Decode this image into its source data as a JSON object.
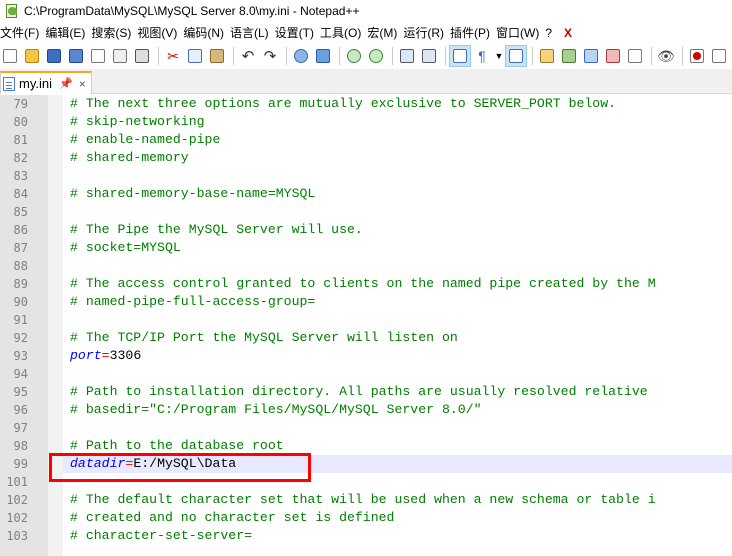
{
  "window": {
    "title": "C:\\ProgramData\\MySQL\\MySQL Server 8.0\\my.ini - Notepad++"
  },
  "menu": {
    "items": [
      "文件(F)",
      "编辑(E)",
      "搜索(S)",
      "视图(V)",
      "编码(N)",
      "语言(L)",
      "设置(T)",
      "工具(O)",
      "宏(M)",
      "运行(R)",
      "插件(P)",
      "窗口(W)",
      "?"
    ],
    "close": "X"
  },
  "toolbar": {
    "icons": [
      "new-file-icon",
      "open-file-icon",
      "save-icon",
      "save-all-icon",
      "close-icon",
      "close-all-icon",
      "print-icon",
      "cut-icon",
      "copy-icon",
      "paste-icon",
      "undo-icon",
      "redo-icon",
      "find-icon",
      "replace-icon",
      "zoom-in-icon",
      "zoom-out-icon",
      "sync-vertical-icon",
      "sync-horizontal-icon",
      "word-wrap-icon",
      "show-all-chars-icon",
      "dropdown-icon",
      "indent-guide-icon",
      "user-language-icon",
      "doc-map-icon",
      "function-list-icon",
      "folder-workspace-icon",
      "monitoring-icon",
      "record-macro-icon"
    ]
  },
  "tab": {
    "label": "my.ini",
    "pin": "📌",
    "close": "×"
  },
  "editor": {
    "lines": [
      {
        "no": "79",
        "parts": [
          {
            "t": "c",
            "s": "# The next three options are mutually exclusive to SERVER_PORT below."
          }
        ]
      },
      {
        "no": "80",
        "parts": [
          {
            "t": "c",
            "s": "# skip-networking"
          }
        ]
      },
      {
        "no": "81",
        "parts": [
          {
            "t": "c",
            "s": "# enable-named-pipe"
          }
        ]
      },
      {
        "no": "82",
        "parts": [
          {
            "t": "c",
            "s": "# shared-memory"
          }
        ]
      },
      {
        "no": "83",
        "parts": []
      },
      {
        "no": "84",
        "parts": [
          {
            "t": "c",
            "s": "# shared-memory-base-name=MYSQL"
          }
        ]
      },
      {
        "no": "85",
        "parts": []
      },
      {
        "no": "86",
        "parts": [
          {
            "t": "c",
            "s": "# The Pipe the MySQL Server will use."
          }
        ]
      },
      {
        "no": "87",
        "parts": [
          {
            "t": "c",
            "s": "# socket=MYSQL"
          }
        ]
      },
      {
        "no": "88",
        "parts": []
      },
      {
        "no": "89",
        "parts": [
          {
            "t": "c",
            "s": "# The access control granted to clients on the named pipe created by the M"
          }
        ]
      },
      {
        "no": "90",
        "parts": [
          {
            "t": "c",
            "s": "# named-pipe-full-access-group="
          }
        ]
      },
      {
        "no": "91",
        "parts": []
      },
      {
        "no": "92",
        "parts": [
          {
            "t": "c",
            "s": "# The TCP/IP Port the MySQL Server will listen on"
          }
        ]
      },
      {
        "no": "93",
        "parts": [
          {
            "t": "k",
            "s": "port"
          },
          {
            "t": "o",
            "s": "="
          },
          {
            "t": "v",
            "s": "3306"
          }
        ]
      },
      {
        "no": "94",
        "parts": []
      },
      {
        "no": "95",
        "parts": [
          {
            "t": "c",
            "s": "# Path to installation directory. All paths are usually resolved relative"
          }
        ]
      },
      {
        "no": "96",
        "parts": [
          {
            "t": "c",
            "s": "# basedir=\"C:/Program Files/MySQL/MySQL Server 8.0/\""
          }
        ]
      },
      {
        "no": "97",
        "parts": []
      },
      {
        "no": "98",
        "parts": [
          {
            "t": "c",
            "s": "# Path to the database root"
          }
        ]
      },
      {
        "no": "99",
        "current": true,
        "parts": [
          {
            "t": "k",
            "s": "datadir"
          },
          {
            "t": "o",
            "s": "="
          },
          {
            "t": "v",
            "s": "E:/MySQL\\Data"
          }
        ]
      },
      {
        "no": "101",
        "parts": []
      },
      {
        "no": "102",
        "parts": [
          {
            "t": "c",
            "s": "# The default character set that will be used when a new schema or table i"
          }
        ]
      },
      {
        "no": "102",
        "parts": [
          {
            "t": "c",
            "s": "# created and no character set is defined"
          }
        ]
      },
      {
        "no": "103",
        "parts": [
          {
            "t": "c",
            "s": "# character-set-server="
          }
        ]
      }
    ]
  },
  "colors": {
    "comment": "#008000",
    "keyword": "#0000ff",
    "operator": "#ff0000",
    "highlight_box": "#ff0000",
    "tab_accent": "#f5a623"
  }
}
